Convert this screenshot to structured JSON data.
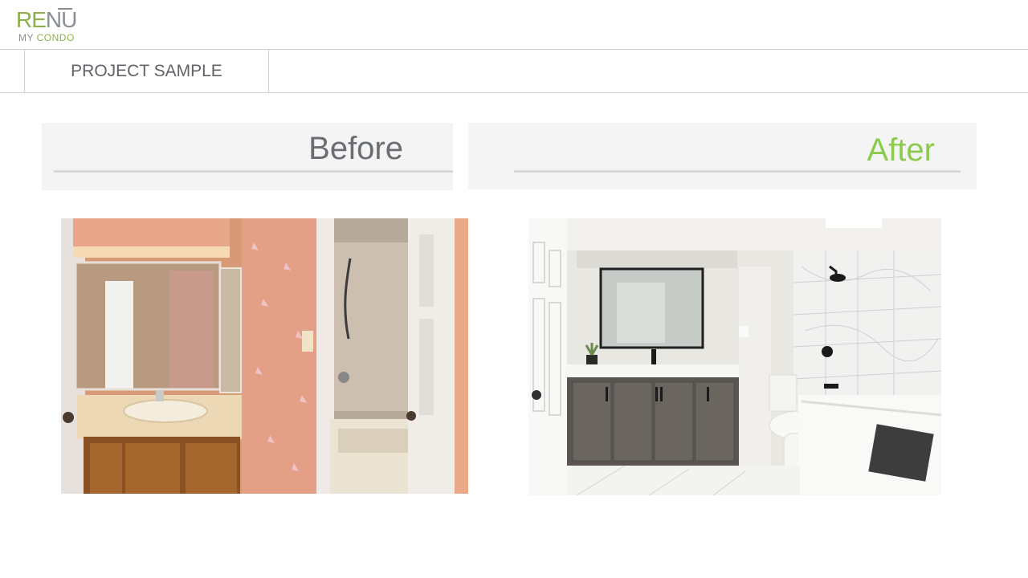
{
  "logo": {
    "brand_part1": "RE",
    "brand_part2": "NU",
    "sub_part1": "MY ",
    "sub_part2": "CONDO"
  },
  "header": {
    "section_title": "PROJECT SAMPLE"
  },
  "comparison": {
    "before_label": "Before",
    "after_label": "After"
  },
  "colors": {
    "brand_green": "#8cb04b",
    "after_green": "#8ccb4d",
    "text_gray": "#6a6e72"
  }
}
